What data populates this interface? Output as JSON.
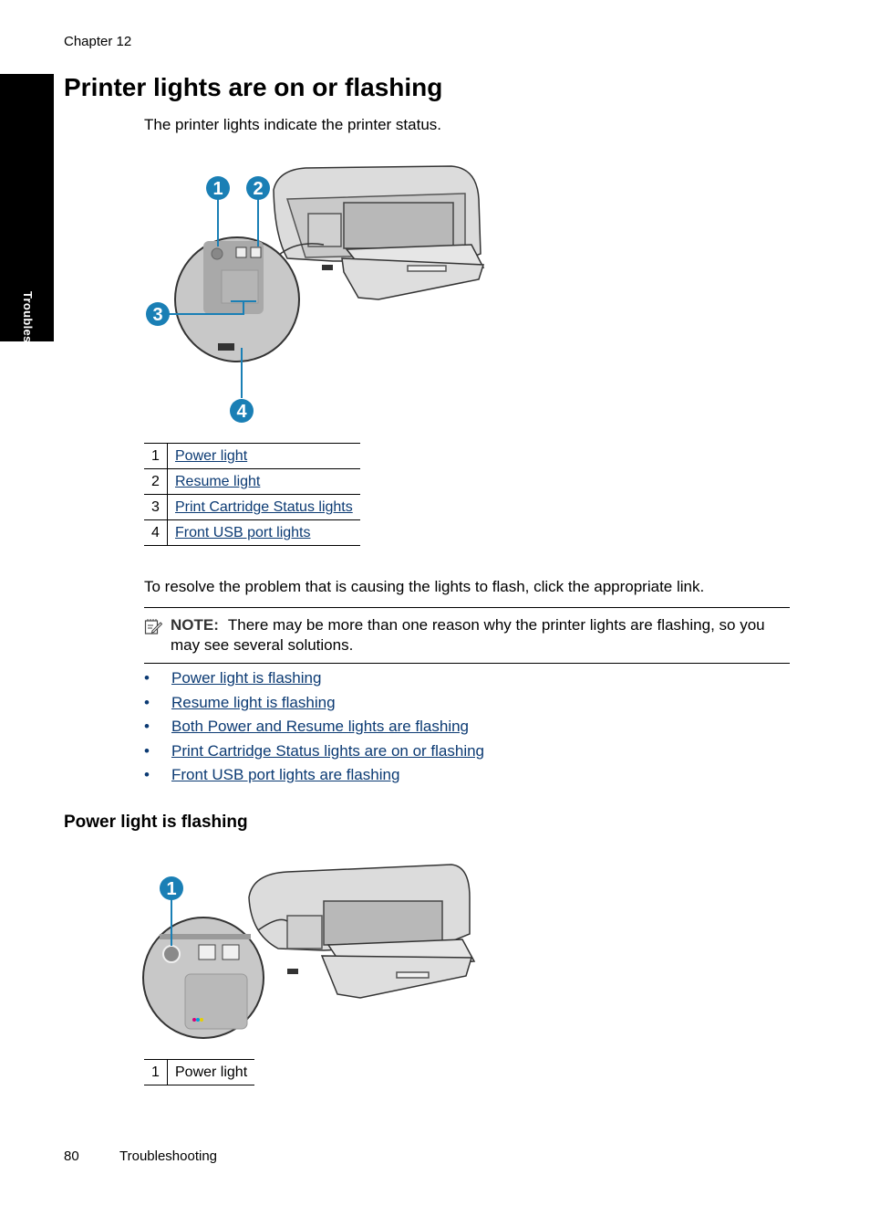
{
  "header": {
    "chapter": "Chapter 12"
  },
  "side_tab": {
    "label": "Troubleshooting"
  },
  "title": "Printer lights are on or flashing",
  "intro": "The printer lights indicate the printer status.",
  "figure1": {
    "callouts": [
      "1",
      "2",
      "3",
      "4"
    ],
    "accent_color": "#1a7fb5"
  },
  "callout_table": {
    "rows": [
      {
        "num": "1",
        "label": "Power light"
      },
      {
        "num": "2",
        "label": "Resume light"
      },
      {
        "num": "3",
        "label": "Print Cartridge Status lights"
      },
      {
        "num": "4",
        "label": "Front USB port lights"
      }
    ]
  },
  "resolve_text": "To resolve the problem that is causing the lights to flash, click the appropriate link.",
  "note": {
    "icon": "note-pencil-icon",
    "label": "NOTE:",
    "text": "There may be more than one reason why the printer lights are flashing, so you may see several solutions."
  },
  "links": [
    {
      "bullet": "•",
      "label": "Power light is flashing"
    },
    {
      "bullet": "•",
      "label": "Resume light is flashing"
    },
    {
      "bullet": "•",
      "label": "Both Power and Resume lights are flashing"
    },
    {
      "bullet": "•",
      "label": "Print Cartridge Status lights are on or flashing"
    },
    {
      "bullet": "•",
      "label": "Front USB port lights are flashing"
    }
  ],
  "section": {
    "title": "Power light is flashing",
    "figure_callouts": [
      "1"
    ],
    "table": {
      "rows": [
        {
          "num": "1",
          "label": "Power light"
        }
      ]
    }
  },
  "footer": {
    "page_number": "80",
    "section": "Troubleshooting"
  },
  "colors": {
    "link": "#0b3a73",
    "callout": "#1a7fb5",
    "side_tab": "#000000"
  }
}
